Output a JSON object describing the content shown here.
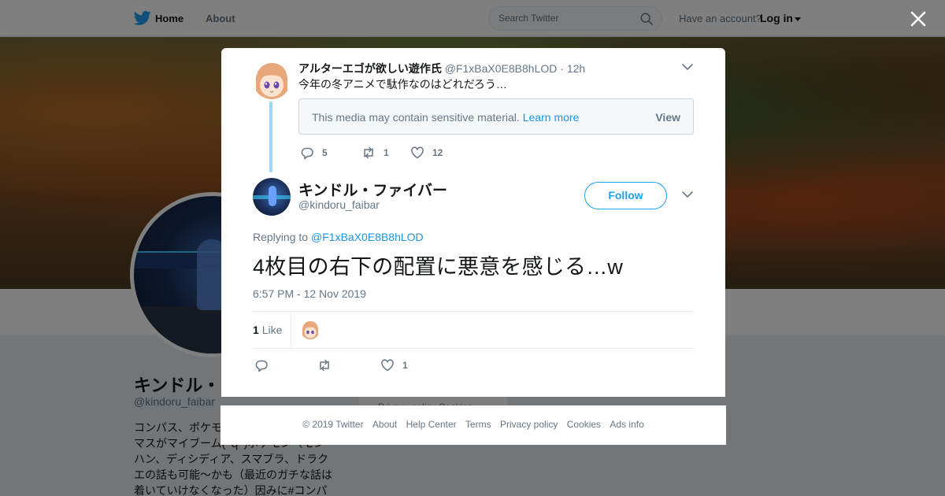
{
  "topbar": {
    "nav_home": "Home",
    "nav_about": "About",
    "search_placeholder": "Search Twitter",
    "have_account": "Have an account?",
    "login": "Log in"
  },
  "profile": {
    "name": "キンドル・ファイバー",
    "handle": "@kindoru_faibar",
    "bio_lines": [
      "コンパス、ポケモ",
      "マスがマイブーム(´ｑ`)ポケモン（モン",
      "ハン、ディシディア、スマブラ、ドラク",
      "エの話も可能～かも（最近のガチな話は",
      "着いていけなくなった）因みに#コンパ"
    ],
    "side_card_text": "Privacy policy  Cookies"
  },
  "parent_tweet": {
    "name": "アルターエゴが欲しい遊作氏",
    "handle": "@F1xBaX0E8B8hLOD",
    "dot": "·",
    "time": "12h",
    "text": "今年の冬アニメで駄作なのはどれだろう…",
    "sensitive_msg": "This media may contain sensitive material.",
    "learn_more": "Learn more",
    "view": "View",
    "replies": "5",
    "retweets": "1",
    "likes": "12"
  },
  "main_tweet": {
    "name": "キンドル・ファイバー",
    "handle": "@kindoru_faibar",
    "follow": "Follow",
    "replying_label": "Replying to",
    "replying_to": "@F1xBaX0E8B8hLOD",
    "text": "4枚目の右下の配置に悪意を感じる…w",
    "timestamp": "6:57 PM - 12 Nov 2019",
    "like_count": "1",
    "like_label": "Like",
    "action_likes": "1"
  },
  "footer": {
    "links": [
      "© 2019 Twitter",
      "About",
      "Help Center",
      "Terms",
      "Privacy policy",
      "Cookies",
      "Ads info"
    ]
  },
  "colors": {
    "twitter_blue": "#1da1f2",
    "link_blue": "#1b95e0",
    "thread_line": "#9fd6f5",
    "gray_text": "#657786"
  },
  "icons": {
    "logo": "twitter-bird-icon",
    "search": "search-icon",
    "close": "close-icon",
    "caret": "caret-down-icon",
    "chevron": "chevron-down-icon",
    "reply": "reply-icon",
    "retweet": "retweet-icon",
    "like": "heart-icon"
  }
}
